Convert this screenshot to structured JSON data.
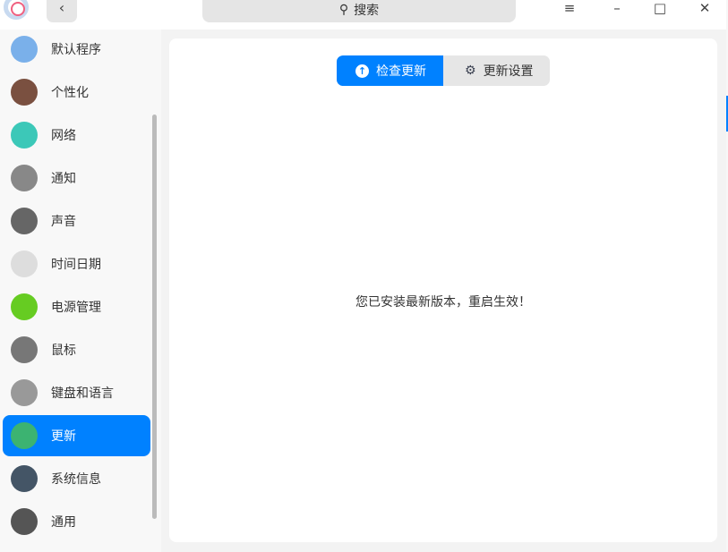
{
  "titlebar": {
    "search_placeholder": "搜索"
  },
  "sidebar": {
    "items": [
      {
        "label": "默认程序",
        "color": "#7ab0ea"
      },
      {
        "label": "个性化",
        "color": "#7a5040"
      },
      {
        "label": "网络",
        "color": "#3cc8b8"
      },
      {
        "label": "通知",
        "color": "#888888"
      },
      {
        "label": "声音",
        "color": "#666666"
      },
      {
        "label": "时间日期",
        "color": "#dddddd"
      },
      {
        "label": "电源管理",
        "color": "#66cc22"
      },
      {
        "label": "鼠标",
        "color": "#777777"
      },
      {
        "label": "键盘和语言",
        "color": "#999999"
      },
      {
        "label": "更新",
        "color": "#3cb371"
      },
      {
        "label": "系统信息",
        "color": "#445566"
      },
      {
        "label": "通用",
        "color": "#555555"
      }
    ],
    "selected": "更新"
  },
  "main": {
    "tabs": [
      {
        "label": "检查更新",
        "active": true
      },
      {
        "label": "更新设置",
        "active": false
      }
    ],
    "message": "您已安装最新版本，重启生效！"
  },
  "colors": {
    "accent": "#0081ff"
  }
}
